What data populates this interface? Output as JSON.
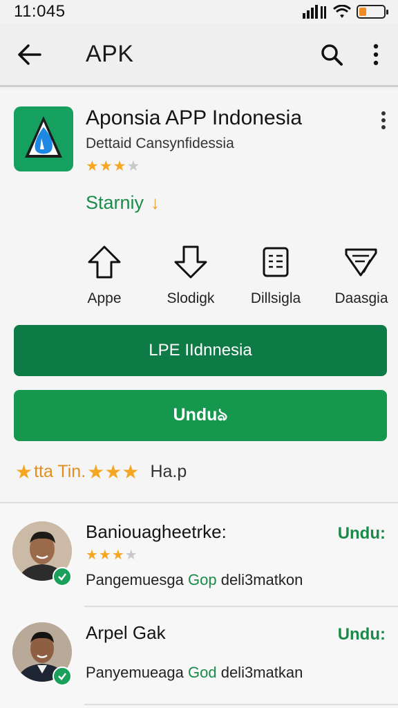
{
  "status_bar": {
    "time": "11:045",
    "icons": [
      "signal-icon",
      "wifi-icon",
      "battery-icon"
    ],
    "battery_level": 0.3
  },
  "app_bar": {
    "title": "APK",
    "icons": [
      "back-arrow-icon",
      "search-icon",
      "more-vert-icon"
    ]
  },
  "app": {
    "name": "Aponsia APP Indonesia",
    "developer": "Dettaid Cansynfidessia",
    "rating_stars": 3,
    "rating_max": 4,
    "status_label": "Starniy",
    "status_arrow": "↓",
    "icon_color": "#16a060"
  },
  "quick_actions": [
    {
      "label": "Appe",
      "icon": "upload-arrow-icon"
    },
    {
      "label": "Slodigk",
      "icon": "download-arrow-icon"
    },
    {
      "label": "Dillsigla",
      "icon": "document-icon"
    },
    {
      "label": "Daasgia",
      "icon": "share-icon"
    }
  ],
  "buttons": {
    "primary_label": "LPE IIdnnesia",
    "install_label": "Unduঌ"
  },
  "rating_summary": {
    "text": "tta Tin.",
    "count": "Ha.p"
  },
  "reviews": [
    {
      "name": "Baniouagheetrke:",
      "stars": 3,
      "stars_max": 4,
      "text_before": "Pangemuesga ",
      "text_highlight": "Gop",
      "text_after": " deli3matkon",
      "action": "Undu:"
    },
    {
      "name": "Arpel Gak",
      "text_before": "Panyemueaga ",
      "text_highlight": "God",
      "text_after": " deli3matkan",
      "action": "Undu:"
    }
  ],
  "colors": {
    "accent_green": "#16974e",
    "dark_green": "#0e7a45",
    "star_orange": "#f5a623"
  }
}
